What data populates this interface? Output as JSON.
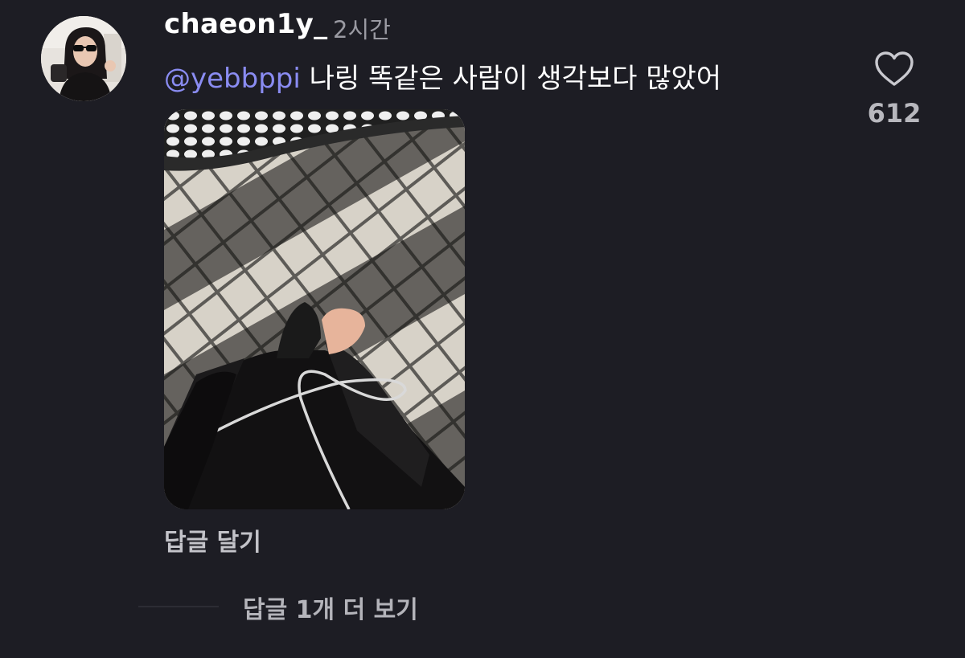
{
  "comment": {
    "username": "chaeon1y_",
    "timestamp": "2시간",
    "mention_at": "@",
    "mention_handle": "yebbppi",
    "text": " 나링 똑같은 사람이 생각보다 많았어",
    "like_count": "612",
    "reply_label": "답글 달기",
    "more_replies_label": "답글 1개 더 보기"
  },
  "icons": {
    "like": "heart-icon",
    "mention": "threads-at-icon"
  },
  "colors": {
    "background": "#1d1d24",
    "mention": "#8a8cf2",
    "muted_text": "#9a9aa2"
  }
}
